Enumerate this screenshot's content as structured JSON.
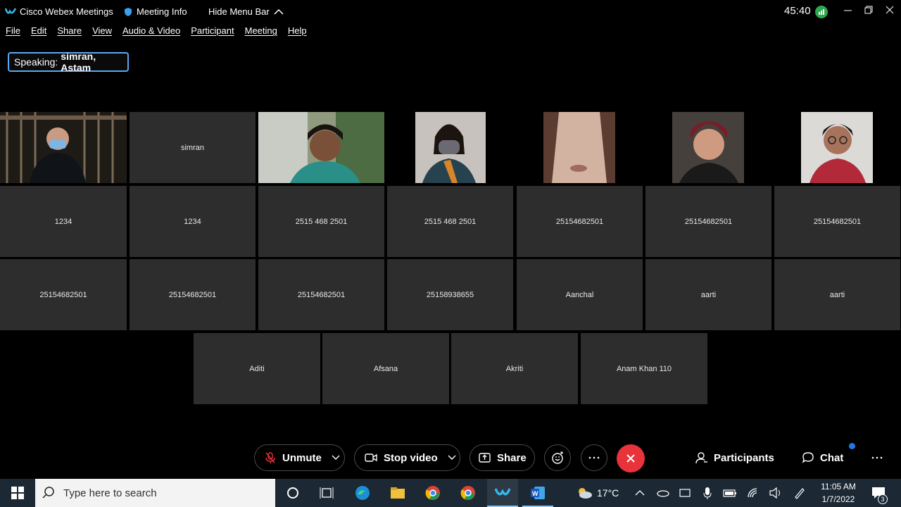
{
  "titlebar": {
    "app_title": "Cisco Webex Meetings",
    "meeting_info": "Meeting Info",
    "hide_menu": "Hide Menu Bar",
    "timer": "45:40"
  },
  "menu": [
    "File",
    "Edit",
    "Share",
    "View",
    "Audio & Video",
    "Participant",
    "Meeting",
    "Help"
  ],
  "speaking": {
    "label": "Speaking:",
    "names": "simran, Astam"
  },
  "row1_labels": {
    "simran": "simran"
  },
  "row2": [
    "1234",
    "1234",
    "2515 468 2501",
    "2515 468 2501",
    "25154682501",
    "25154682501",
    "25154682501"
  ],
  "row3": [
    "25154682501",
    "25154682501",
    "25154682501",
    "25158938655",
    "Aanchal",
    "aarti",
    "aarti"
  ],
  "row4": [
    "Aditi",
    "Afsana",
    "Akriti",
    "Anam Khan 110"
  ],
  "controls": {
    "unmute": "Unmute",
    "stop_video": "Stop video",
    "share": "Share",
    "participants": "Participants",
    "chat": "Chat"
  },
  "taskbar": {
    "search_placeholder": "Type here to search",
    "weather": "17°C",
    "time": "11:05 AM",
    "date": "1/7/2022",
    "notifications": "3"
  },
  "colors": {
    "end_call": "#e8333a",
    "speaking_border": "#5ca7f3",
    "accent": "#1f7ae0"
  }
}
